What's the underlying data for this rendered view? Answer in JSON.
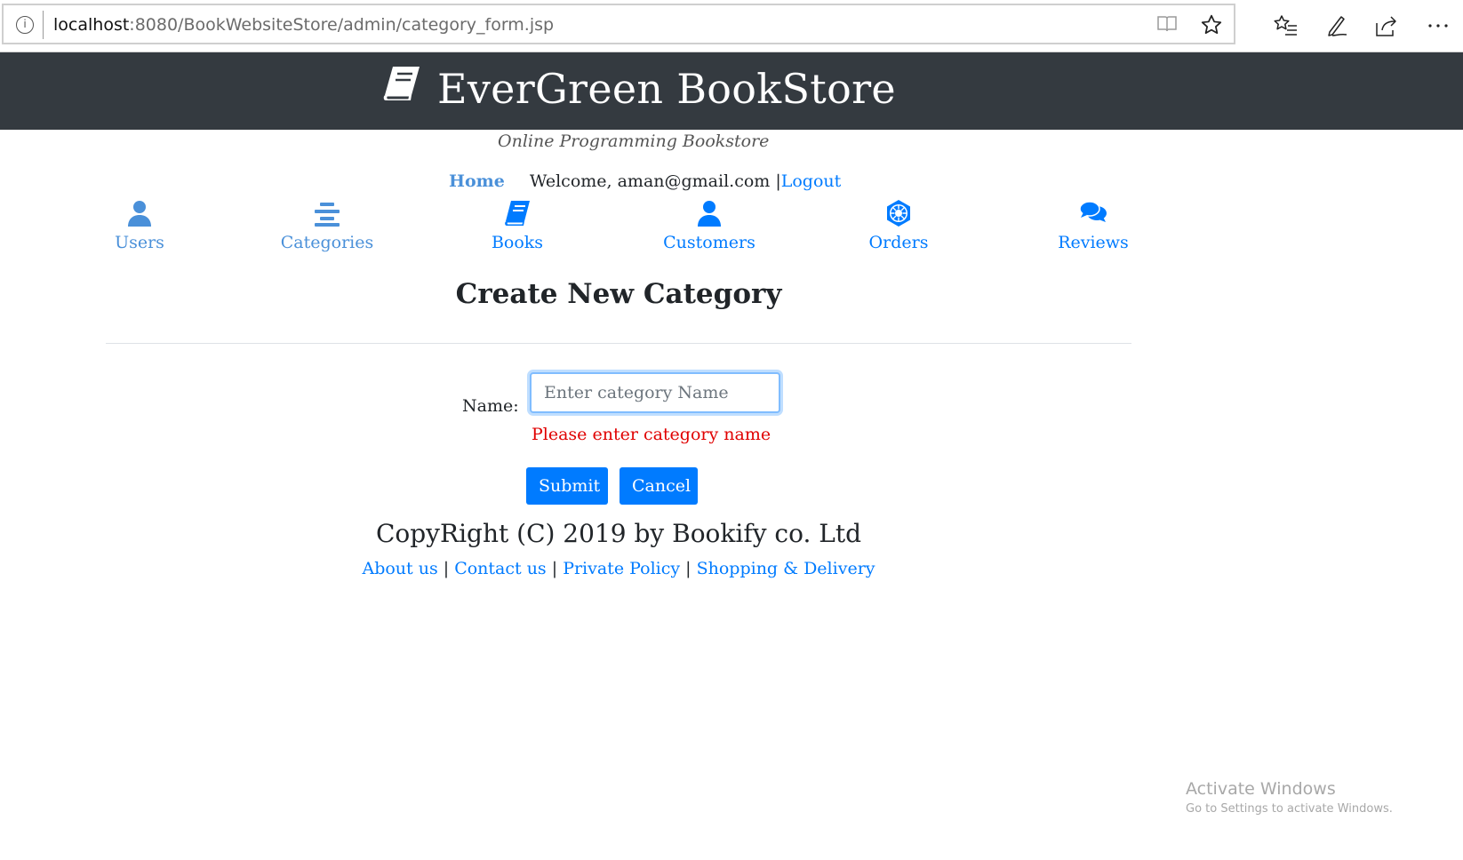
{
  "browser": {
    "url_host": "localhost",
    "url_path": ":8080/BookWebsiteStore/admin/category_form.jsp",
    "icons": [
      "info-icon",
      "reading-view-icon",
      "favorite-star-icon",
      "favorites-list-icon",
      "pen-notes-icon",
      "share-icon",
      "more-icon"
    ]
  },
  "header": {
    "brand": "EverGreen BookStore",
    "brand_icon": "book-icon",
    "background": "#343a40"
  },
  "tagline": "Online Programming Bookstore",
  "userbar": {
    "home": "Home",
    "welcome": "Welcome, aman@gmail.com |",
    "logout": "Logout"
  },
  "nav": {
    "items": [
      {
        "label": "Users",
        "icon": "user-icon"
      },
      {
        "label": "Categories",
        "icon": "list-icon"
      },
      {
        "label": "Books",
        "icon": "book-icon"
      },
      {
        "label": "Customers",
        "icon": "customer-icon"
      },
      {
        "label": "Orders",
        "icon": "orders-icon"
      },
      {
        "label": "Reviews",
        "icon": "comments-icon"
      }
    ]
  },
  "form": {
    "title": "Create New Category",
    "name_label": "Name:",
    "name_value": "",
    "name_placeholder": "Enter category Name",
    "error": "Please enter category name",
    "submit": "Submit",
    "cancel": "Cancel"
  },
  "footer": {
    "copyright": "CopyRight (C) 2019 by Bookify co. Ltd",
    "links": [
      "About us",
      "Contact us",
      "Private Policy",
      "Shopping & Delivery"
    ],
    "separator": "|"
  },
  "watermark": {
    "title": "Activate Windows",
    "subtitle": "Go to Settings to activate Windows."
  },
  "colors": {
    "accent": "#007bff",
    "accent_light": "#4a90d9",
    "error": "#e00000"
  }
}
